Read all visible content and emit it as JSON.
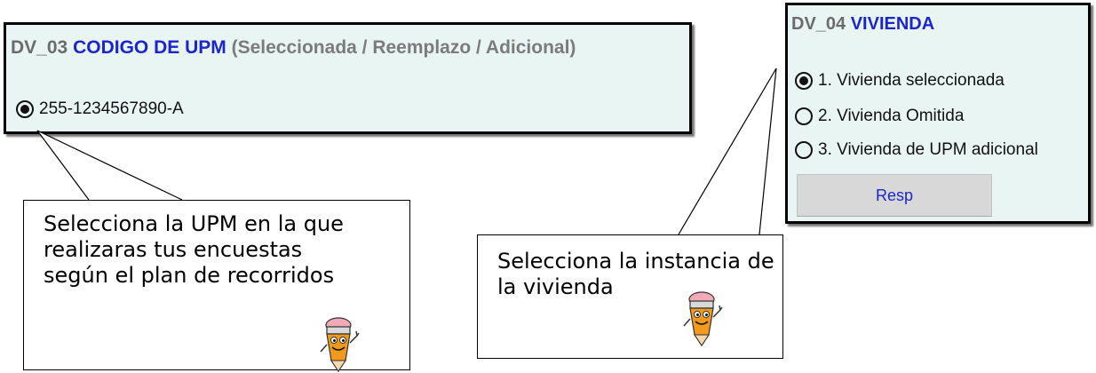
{
  "panels": {
    "dv03": {
      "code": "DV_03",
      "name": "CODIGO DE UPM",
      "note": "(Seleccionada / Reemplazo / Adicional)",
      "option": {
        "label": "255-1234567890-A",
        "checked": true
      }
    },
    "dv04": {
      "code": "DV_04",
      "name": "VIVIENDA",
      "options": [
        {
          "label": "1. Vivienda seleccionada",
          "checked": true
        },
        {
          "label": "2. Vivienda Omitida",
          "checked": false
        },
        {
          "label": "3. Vivienda de UPM adicional",
          "checked": false
        }
      ],
      "resp_label": "Resp"
    }
  },
  "callouts": {
    "upm": "Selecciona la UPM en la que\nrealizaras tus encuestas\nsegún el plan de recorridos",
    "vivienda": "Selecciona la instancia de\nla vivienda"
  },
  "colors": {
    "panel_bg": "#e9f5f2",
    "accent_blue": "#1c26c8",
    "header_gray": "#6b6b6b"
  },
  "icons": [
    "radio-icon",
    "pencil-mascot-icon"
  ]
}
